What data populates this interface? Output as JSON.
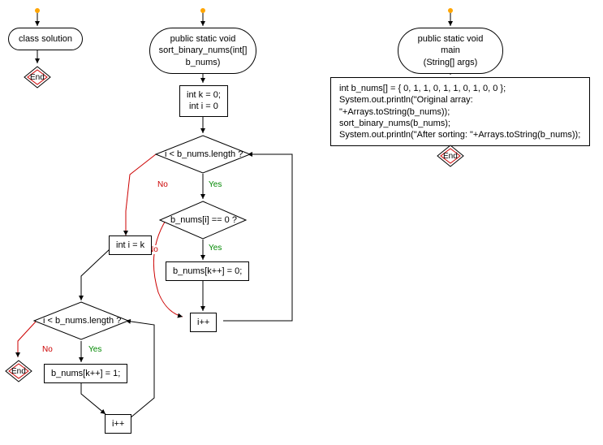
{
  "flowchart": {
    "col1": {
      "class_solution": "class solution",
      "end1": "End"
    },
    "col2": {
      "method": "public static void\nsort_binary_nums(int[]\nb_nums)",
      "init": "int k = 0;\nint i = 0",
      "cond1": "i < b_nums.length ?",
      "cond2": "b_nums[i] == 0 ?",
      "assign_zero": "b_nums[k++] = 0;",
      "reset_i": "int i = k",
      "cond3": "i < b_nums.length ?",
      "assign_one": "b_nums[k++] = 1;",
      "inc1": "i++",
      "inc2": "i++",
      "end2": "End"
    },
    "col3": {
      "main": "public static void main\n(String[] args)",
      "code": "int b_nums[] = { 0, 1, 1, 0, 1, 1, 0, 1, 0, 0 };\nSystem.out.println(\"Original array: \"+Arrays.toString(b_nums));\nsort_binary_nums(b_nums);\nSystem.out.println(\"After sorting: \"+Arrays.toString(b_nums));",
      "end3": "End"
    },
    "labels": {
      "yes": "Yes",
      "no": "No"
    }
  }
}
